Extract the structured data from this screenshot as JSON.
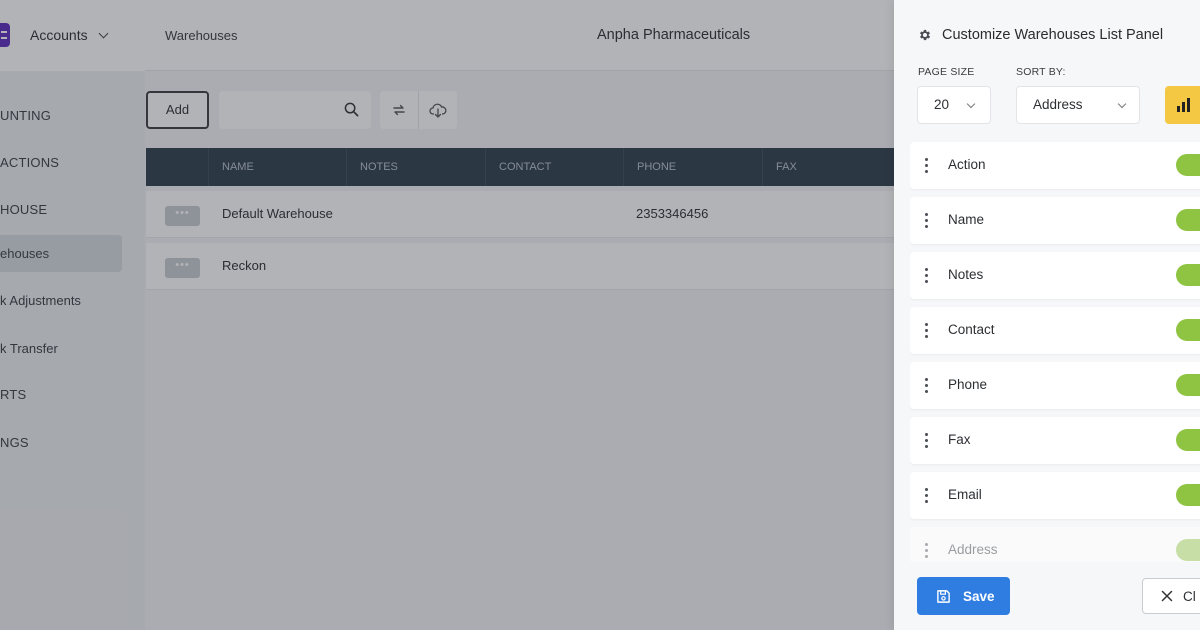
{
  "header": {
    "app_switcher_label": "Accounts",
    "breadcrumb": "Warehouses",
    "company_name": "Anpha Pharmaceuticals"
  },
  "sidebar": {
    "items": [
      {
        "label": "UNTING",
        "type": "section"
      },
      {
        "label": "ACTIONS",
        "type": "section"
      },
      {
        "label": "HOUSE",
        "type": "section"
      },
      {
        "label": "ehouses",
        "type": "item",
        "active": true
      },
      {
        "label": "k Adjustments",
        "type": "item"
      },
      {
        "label": "k Transfer",
        "type": "item"
      },
      {
        "label": "RTS",
        "type": "section"
      },
      {
        "label": "NGS",
        "type": "section"
      }
    ]
  },
  "toolbar": {
    "add_label": "Add",
    "search_placeholder": ""
  },
  "table": {
    "columns": [
      "NAME",
      "NOTES",
      "CONTACT",
      "PHONE",
      "FAX"
    ],
    "rows": [
      {
        "menu": "•••",
        "name": "Default Warehouse",
        "notes": "",
        "contact": "",
        "phone": "2353346456",
        "fax": ""
      },
      {
        "menu": "•••",
        "name": "Reckon",
        "notes": "",
        "contact": "",
        "phone": "",
        "fax": ""
      }
    ]
  },
  "panel": {
    "title": "Customize Warehouses List Panel",
    "page_size_label": "PAGE SIZE",
    "page_size_value": "20",
    "sort_by_label": "SORT BY:",
    "sort_by_value": "Address",
    "columns": [
      {
        "label": "Action",
        "enabled": true
      },
      {
        "label": "Name",
        "enabled": true
      },
      {
        "label": "Notes",
        "enabled": true
      },
      {
        "label": "Contact",
        "enabled": true
      },
      {
        "label": "Phone",
        "enabled": true
      },
      {
        "label": "Fax",
        "enabled": true
      },
      {
        "label": "Email",
        "enabled": true
      },
      {
        "label": "Address",
        "enabled": true
      }
    ],
    "save_label": "Save",
    "close_label": "Cl"
  },
  "colors": {
    "accent_blue": "#2f7de1",
    "toggle_green": "#8fc442",
    "sort_yellow": "#f4c842",
    "table_header": "#2f3d4e",
    "logo_purple": "#5b2bbf"
  }
}
